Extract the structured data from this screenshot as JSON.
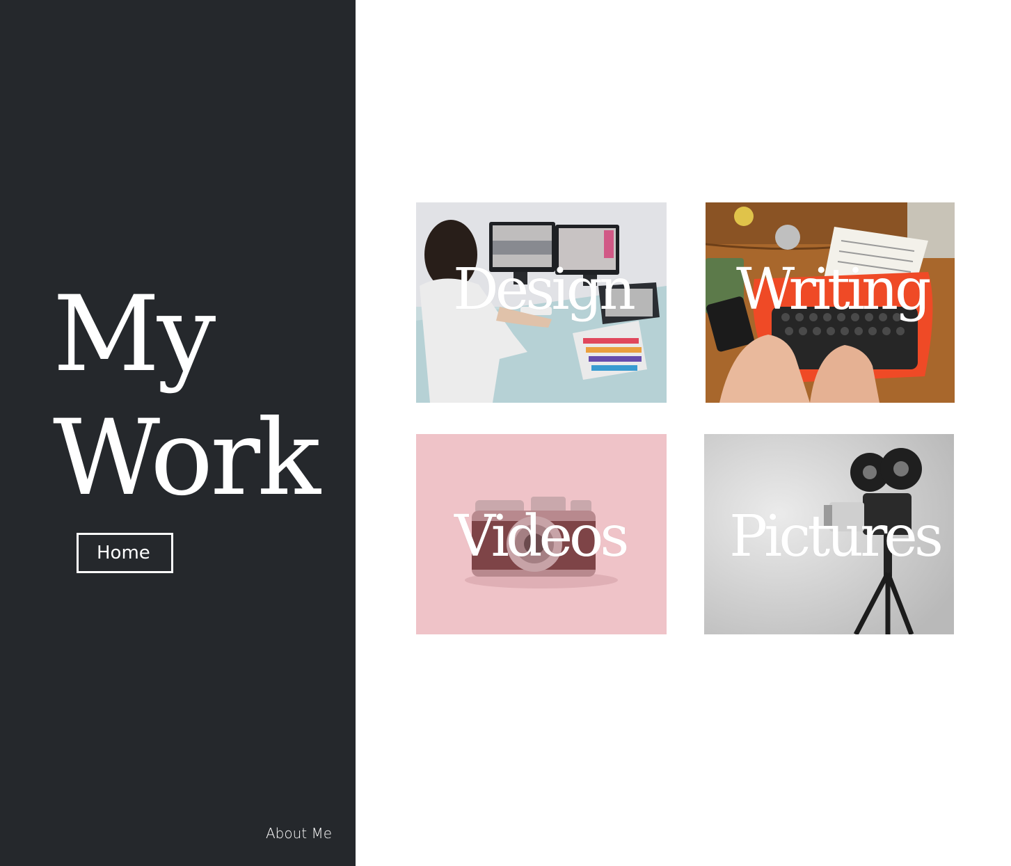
{
  "sidebar": {
    "title_line1": "My",
    "title_line2": "Work",
    "home_label": "Home",
    "about_label": "About Me",
    "background": "#25282c"
  },
  "gallery": {
    "tiles": [
      {
        "label": "Design",
        "image": "designer-at-dual-monitors-photo"
      },
      {
        "label": "Writing",
        "image": "hands-on-red-typewriter-photo"
      },
      {
        "label": "Videos",
        "image": "vintage-camera-on-pink-photo"
      },
      {
        "label": "Pictures",
        "image": "film-camera-on-tripod-photo"
      }
    ]
  }
}
